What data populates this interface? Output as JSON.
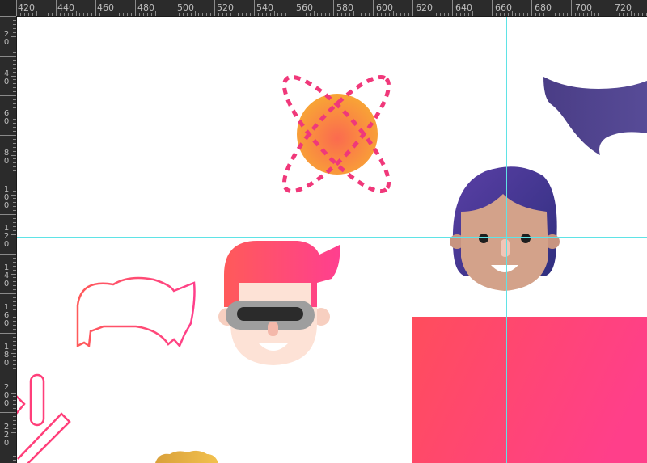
{
  "rulers": {
    "top_labels": [
      "420",
      "440",
      "460",
      "480",
      "500",
      "520",
      "540",
      "560",
      "580",
      "600",
      "620",
      "640",
      "660",
      "680",
      "700",
      "720"
    ],
    "left_labels": [
      [
        "2",
        "0"
      ],
      [
        "4",
        "0"
      ],
      [
        "6",
        "0"
      ],
      [
        "8",
        "0"
      ],
      [
        "1",
        "0",
        "0"
      ],
      [
        "1",
        "2",
        "0"
      ],
      [
        "1",
        "4",
        "0"
      ],
      [
        "1",
        "6",
        "0"
      ],
      [
        "1",
        "8",
        "0"
      ],
      [
        "2",
        "0",
        "0"
      ],
      [
        "2",
        "2",
        "0"
      ]
    ]
  },
  "colors": {
    "guide": "#5fe3e6",
    "ruler_bg": "#2b2b2b",
    "pink": "#ff4a6e",
    "orange": "#f7a43a",
    "purple": "#4b3f8f",
    "skin_dark": "#d3a28a",
    "skin_light": "#fbe0d4"
  },
  "canvas_objects": [
    {
      "name": "orange-planet-icon"
    },
    {
      "name": "purple-horn-shape"
    },
    {
      "name": "purple-hair-avatar"
    },
    {
      "name": "pink-hair-visor-avatar"
    },
    {
      "name": "hair-outline-shape"
    },
    {
      "name": "pink-gradient-rectangle"
    },
    {
      "name": "paperclip-outline-shape"
    },
    {
      "name": "gold-curly-hair-shape"
    }
  ]
}
